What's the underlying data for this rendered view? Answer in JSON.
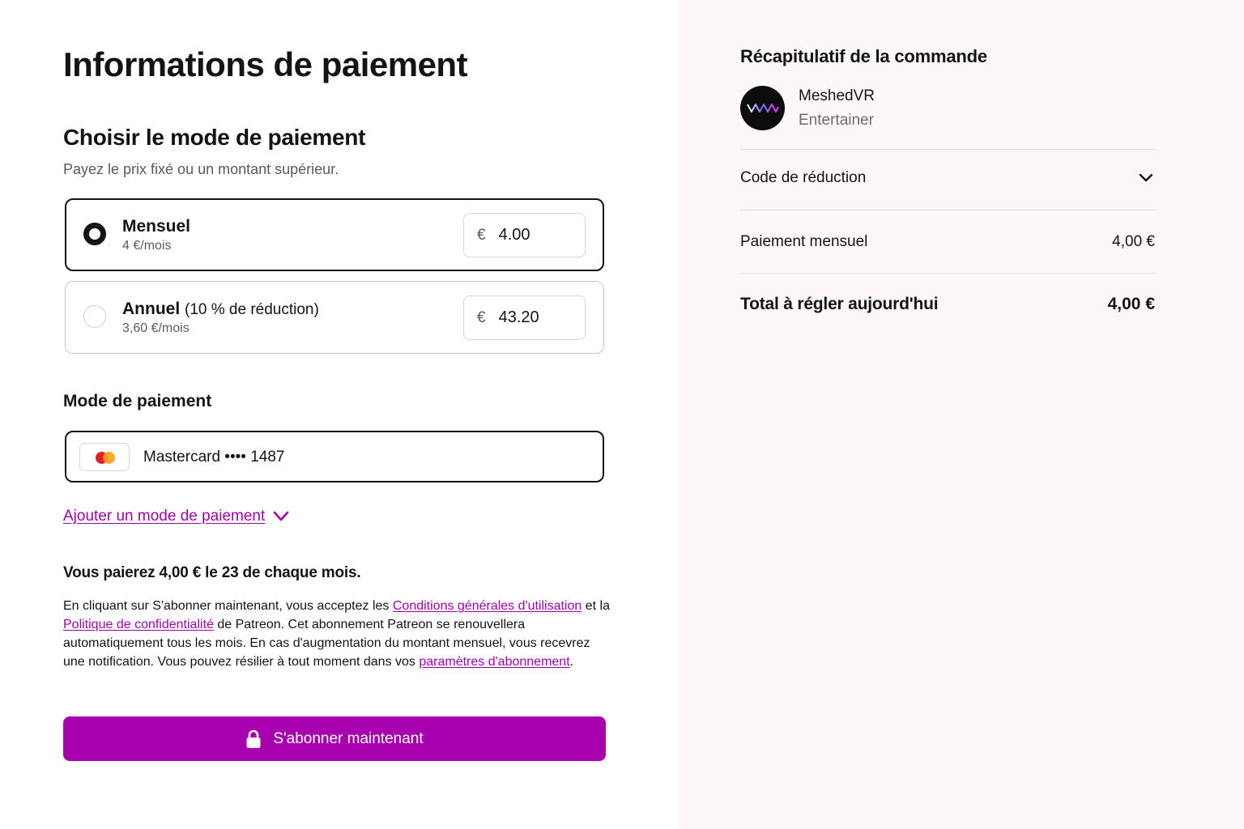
{
  "page": {
    "title": "Informations de paiement"
  },
  "plans": {
    "title": "Choisir le mode de paiement",
    "subtitle": "Payez le prix fixé ou un montant supérieur.",
    "monthly": {
      "name": "Mensuel",
      "price_label": "4 €/mois",
      "currency": "€",
      "amount": "4.00",
      "selected": true
    },
    "annual": {
      "name": "Annuel",
      "discount": "(10 % de réduction)",
      "price_label": "3,60 €/mois",
      "currency": "€",
      "amount": "43.20",
      "selected": false
    }
  },
  "payment_method": {
    "title": "Mode de paiement",
    "card_label": "Mastercard •••• 1487",
    "card_brand_icon": "mastercard-icon",
    "add_label": "Ajouter un mode de paiement"
  },
  "billing": {
    "note": "Vous paierez 4,00 € le 23 de chaque mois.",
    "terms_part1": "En cliquant sur S'abonner maintenant, vous acceptez les ",
    "terms_link1": "Conditions générales d'utilisation",
    "terms_part2": " et la ",
    "terms_link2": "Politique de confidentialité",
    "terms_part3": " de Patreon. Cet abonnement Patreon se renouvellera automatiquement tous les mois. En cas d'augmentation du montant mensuel, vous recevrez une notification. Vous pouvez résilier à tout moment dans vos ",
    "terms_link3": "paramètres d'abonnement",
    "terms_part4": "."
  },
  "subscribe_button": {
    "label": "S'abonner maintenant",
    "icon": "lock-icon"
  },
  "summary": {
    "title": "Récapitulatif de la commande",
    "creator_name": "MeshedVR",
    "creator_role": "Entertainer",
    "discount_code_label": "Code de réduction",
    "monthly_payment_label": "Paiement mensuel",
    "monthly_payment_value": "4,00 €",
    "total_label": "Total à régler aujourd'hui",
    "total_value": "4,00 €"
  },
  "colors": {
    "accent": "#a800ae",
    "link": "#a100a8",
    "text": "#141414",
    "muted": "#5b5b5b",
    "summary_bg": "#fdf7f8"
  }
}
